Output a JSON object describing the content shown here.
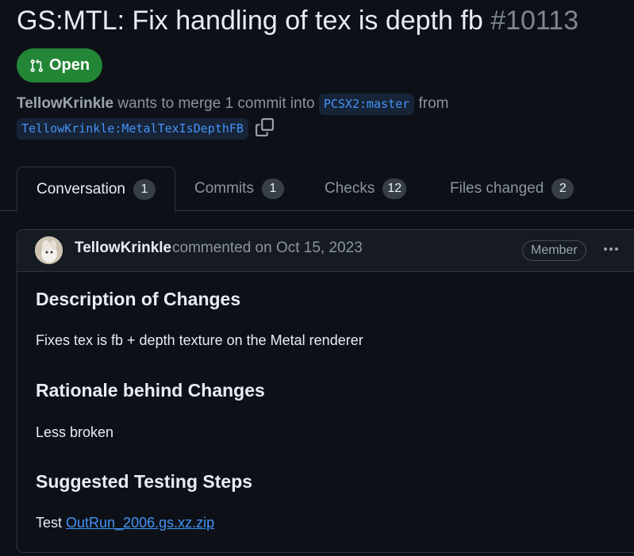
{
  "pr": {
    "title": "GS:MTL: Fix handling of tex is depth fb",
    "number": "#10113",
    "state": "Open",
    "author": "TellowKrinkle",
    "merge_text": "wants to merge 1 commit into",
    "base_branch": "PCSX2:master",
    "from_text": "from",
    "head_branch": "TellowKrinkle:MetalTexIsDepthFB"
  },
  "tabs": [
    {
      "label": "Conversation",
      "count": "1",
      "active": true
    },
    {
      "label": "Commits",
      "count": "1",
      "active": false
    },
    {
      "label": "Checks",
      "count": "12",
      "active": false
    },
    {
      "label": "Files changed",
      "count": "2",
      "active": false
    }
  ],
  "comment": {
    "author": "TellowKrinkle",
    "meta": "commented on Oct 15, 2023",
    "role": "Member",
    "sections": [
      {
        "heading": "Description of Changes",
        "text": "Fixes tex is fb + depth texture on the Metal renderer"
      },
      {
        "heading": "Rationale behind Changes",
        "text": "Less broken"
      },
      {
        "heading": "Suggested Testing Steps",
        "text_prefix": "Test ",
        "link": "OutRun_2006.gs.xz.zip"
      }
    ]
  },
  "colors": {
    "background": "#0d1117",
    "open_green": "#238636",
    "link_blue": "#4493f8"
  },
  "icons": [
    "git-pull-request-icon",
    "copy-icon",
    "kebab-icon"
  ]
}
